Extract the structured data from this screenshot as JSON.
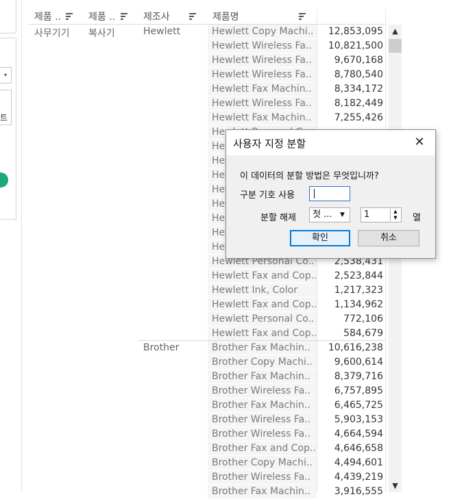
{
  "left_panel": {
    "dropdown_arrow": "▾",
    "button_fragment": "트"
  },
  "headers": [
    {
      "label": "제품 ..",
      "sort_icon": "sort-icon"
    },
    {
      "label": "제품 ..",
      "sort_icon": "sort-icon"
    },
    {
      "label": "제조사",
      "sort_icon": "sort-icon"
    },
    {
      "label": "제품명",
      "sort_icon": "sort-icon"
    }
  ],
  "category": "사무기기",
  "subcategory": "복사기",
  "groups": [
    {
      "manufacturer": "Hewlett"
    },
    {
      "manufacturer": "Brother"
    }
  ],
  "rows": [
    {
      "name": "Hewlett Copy Machi..",
      "value": "12,853,095"
    },
    {
      "name": "Hewlett Wireless Fa..",
      "value": "10,821,500"
    },
    {
      "name": "Hewlett Wireless Fa..",
      "value": "9,670,168"
    },
    {
      "name": "Hewlett Wireless Fa..",
      "value": "8,780,540"
    },
    {
      "name": "Hewlett Fax Machin..",
      "value": "8,334,172"
    },
    {
      "name": "Hewlett Wireless Fa..",
      "value": "8,182,449"
    },
    {
      "name": "Hewlett Fax Machin..",
      "value": "7,255,426"
    },
    {
      "name": "Hewlett Personal Co..",
      "value": ""
    },
    {
      "name": "Hew",
      "value": ""
    },
    {
      "name": "Hew",
      "value": ""
    },
    {
      "name": "Hew",
      "value": ""
    },
    {
      "name": "Hew",
      "value": ""
    },
    {
      "name": "Hew",
      "value": ""
    },
    {
      "name": "Hew",
      "value": ""
    },
    {
      "name": "Hew",
      "value": ""
    },
    {
      "name": "Hew",
      "value": ""
    },
    {
      "name": "Hewlett Personal Co..",
      "value": "2,538,431"
    },
    {
      "name": "Hewlett Fax and Cop..",
      "value": "2,523,844"
    },
    {
      "name": "Hewlett Ink, Color",
      "value": "1,217,323"
    },
    {
      "name": "Hewlett Fax and Cop..",
      "value": "1,134,962"
    },
    {
      "name": "Hewlett Personal Co..",
      "value": "772,106"
    },
    {
      "name": "Hewlett Fax and Cop..",
      "value": "584,679"
    },
    {
      "name": "Brother Fax Machin..",
      "value": "10,616,238"
    },
    {
      "name": "Brother Copy Machi..",
      "value": "9,600,614"
    },
    {
      "name": "Brother Fax Machin..",
      "value": "8,379,716"
    },
    {
      "name": "Brother Wireless Fa..",
      "value": "6,757,895"
    },
    {
      "name": "Brother Fax Machin..",
      "value": "6,465,725"
    },
    {
      "name": "Brother Wireless Fa..",
      "value": "5,903,153"
    },
    {
      "name": "Brother Wireless Fa..",
      "value": "4,664,594"
    },
    {
      "name": "Brother Fax and Cop..",
      "value": "4,646,658"
    },
    {
      "name": "Brother Copy Machi..",
      "value": "4,494,601"
    },
    {
      "name": "Brother Wireless Fa..",
      "value": "4,439,219"
    },
    {
      "name": "Brother Fax Machin..",
      "value": "3,916,555"
    }
  ],
  "scrollbar": {
    "up": "▲",
    "down": "▼"
  },
  "dialog": {
    "title": "사용자 지정 분할",
    "close_glyph": "✕",
    "question": "이 데이터의 분할 방법은 무엇입니까?",
    "separator_label": "구분 기호 사용",
    "separator_value": "",
    "split_label": "분할 해제",
    "split_mode": "첫 ...",
    "split_mode_arrow": "▼",
    "column_count": "1",
    "column_unit": "열",
    "ok_label": "확인",
    "cancel_label": "취소"
  }
}
